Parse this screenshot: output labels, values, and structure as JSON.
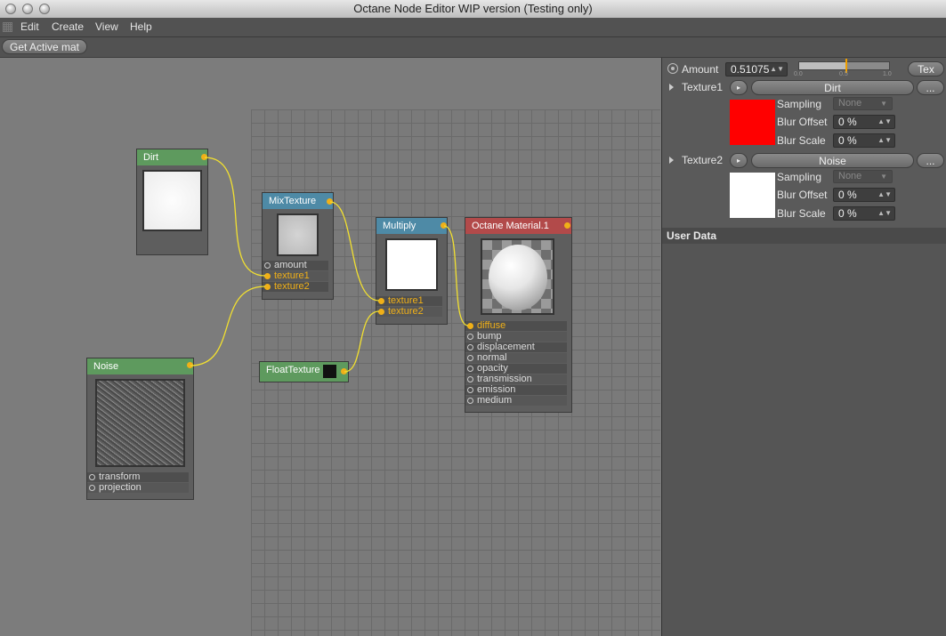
{
  "window": {
    "title": "Octane Node Editor WIP version (Testing only)"
  },
  "menu": [
    "Edit",
    "Create",
    "View",
    "Help"
  ],
  "toolbar": {
    "get_active_mat": "Get Active mat"
  },
  "nodes": {
    "dirt": {
      "title": "Dirt"
    },
    "noise": {
      "title": "Noise",
      "props": [
        "transform",
        "projection"
      ]
    },
    "mix": {
      "title": "MixTexture",
      "props": [
        "amount",
        "texture1",
        "texture2"
      ]
    },
    "multiply": {
      "title": "Multiply",
      "props": [
        "texture1",
        "texture2"
      ]
    },
    "float": {
      "title": "FloatTexture"
    },
    "material": {
      "title": "Octane Material.1",
      "props": [
        "diffuse",
        "bump",
        "displacement",
        "normal",
        "opacity",
        "transmission",
        "emission",
        "medium"
      ]
    }
  },
  "panel": {
    "amount": {
      "label": "Amount",
      "value": "0.51075",
      "fraction": 0.51075,
      "scale": [
        "0.0",
        "0.5",
        "1.0"
      ],
      "tex_button": "Tex"
    },
    "texture1": {
      "label": "Texture1",
      "name": "Dirt",
      "more": "...",
      "swatch": "#ff0000",
      "sampling_label": "Sampling",
      "sampling_value": "None",
      "blur_offset_label": "Blur Offset",
      "blur_offset_value": "0 %",
      "blur_scale_label": "Blur Scale",
      "blur_scale_value": "0 %"
    },
    "texture2": {
      "label": "Texture2",
      "name": "Noise",
      "more": "...",
      "swatch": "#ffffff",
      "sampling_label": "Sampling",
      "sampling_value": "None",
      "blur_offset_label": "Blur Offset",
      "blur_offset_value": "0 %",
      "blur_scale_label": "Blur Scale",
      "blur_scale_value": "0 %"
    },
    "user_data": "User Data"
  },
  "colors": {
    "wire": "#f2e030",
    "port": "#f0b018",
    "accent_amount": "#f0a000"
  }
}
